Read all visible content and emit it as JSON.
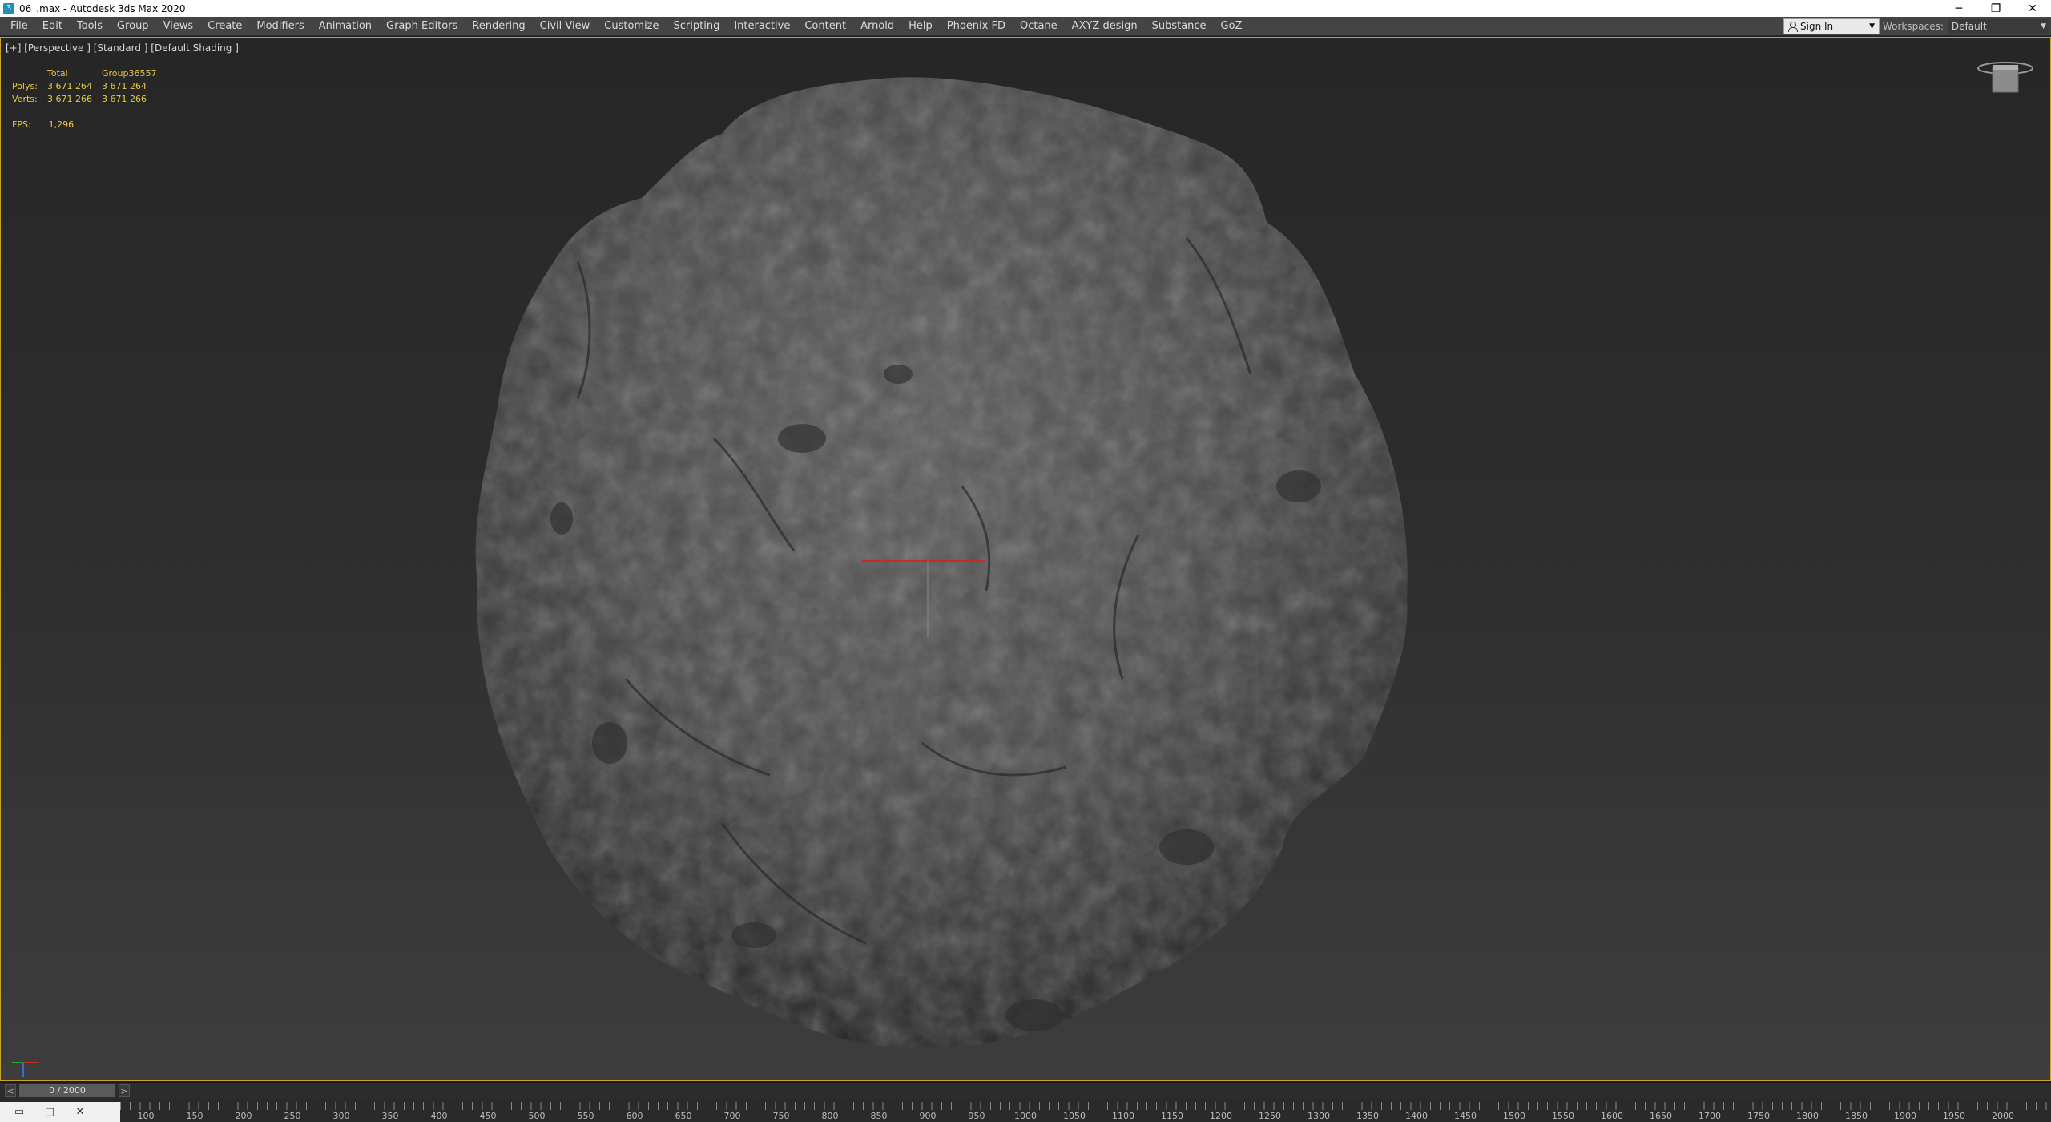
{
  "window": {
    "title": "06_.max - Autodesk 3ds Max 2020",
    "app_icon": "3",
    "controls": {
      "minimize": "─",
      "restore": "❐",
      "close": "✕"
    }
  },
  "menubar": {
    "items": [
      "File",
      "Edit",
      "Tools",
      "Group",
      "Views",
      "Create",
      "Modifiers",
      "Animation",
      "Graph Editors",
      "Rendering",
      "Civil View",
      "Customize",
      "Scripting",
      "Interactive",
      "Content",
      "Arnold",
      "Help",
      "Phoenix FD",
      "Octane",
      "AXYZ design",
      "Substance",
      "GoZ"
    ],
    "signin_label": "Sign In",
    "workspaces_label": "Workspaces:",
    "workspaces_value": "Default"
  },
  "viewport": {
    "label": "[+] [Perspective ] [Standard ] [Default Shading ]",
    "stats": {
      "header": [
        "",
        "Total",
        "Group36557"
      ],
      "rows": [
        {
          "label": "Polys:",
          "total": "3 671 264",
          "selected": "3 671 264"
        },
        {
          "label": "Verts:",
          "total": "3 671 266",
          "selected": "3 671 266"
        }
      ]
    },
    "fps_label": "FPS:",
    "fps_value": "1,296",
    "accent_border": "#c9a227"
  },
  "timeline": {
    "prev": "<",
    "next": ">",
    "frame": "0 / 2000"
  },
  "trackbar": {
    "labels": [
      "100",
      "150",
      "200",
      "250",
      "300",
      "350",
      "400",
      "450",
      "500",
      "550",
      "600",
      "650",
      "700",
      "750",
      "800",
      "850",
      "900",
      "950",
      "1000",
      "1050",
      "1100",
      "1150",
      "1200",
      "1250",
      "1300",
      "1350",
      "1400",
      "1450",
      "1500",
      "1550",
      "1600",
      "1650",
      "1700",
      "1750",
      "1800",
      "1850",
      "1900",
      "1950",
      "2000"
    ]
  }
}
